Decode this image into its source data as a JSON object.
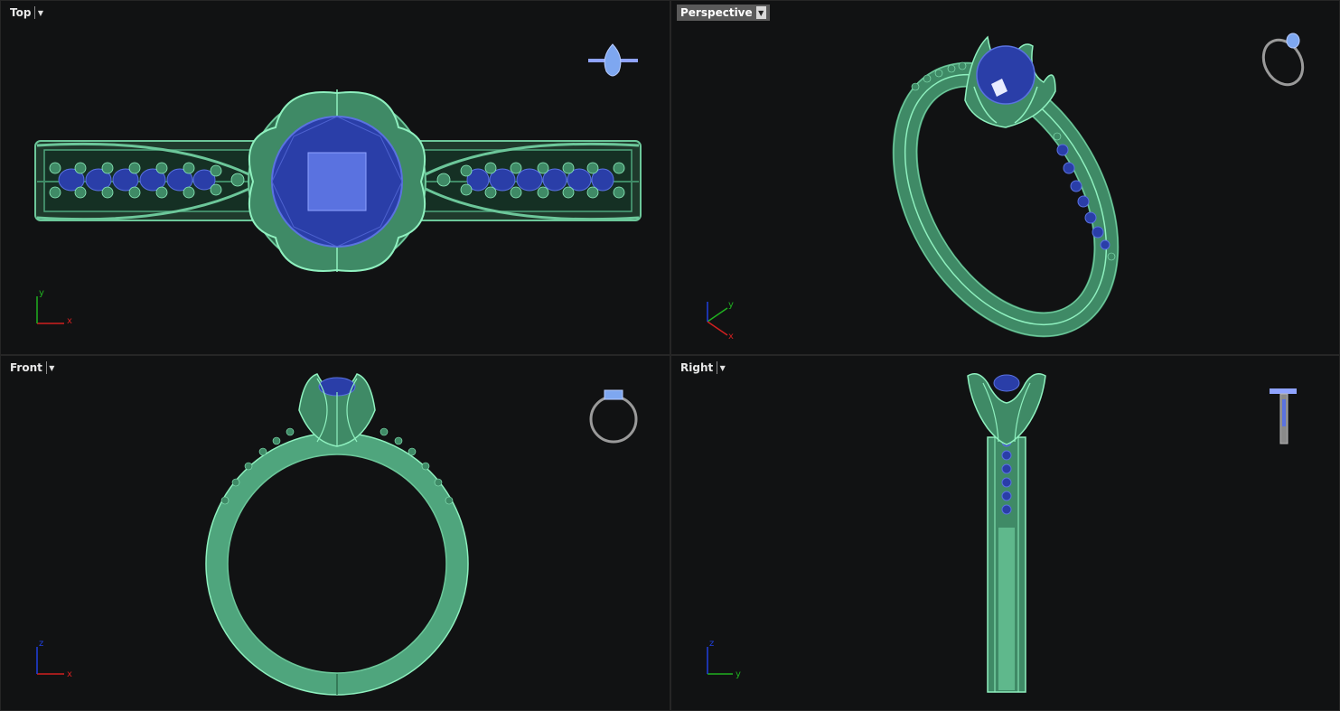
{
  "viewports": {
    "top": {
      "label": "Top",
      "axes": {
        "h": "x",
        "v": "y"
      }
    },
    "perspective": {
      "label": "Perspective",
      "axes": {
        "a": "y",
        "b": "x"
      }
    },
    "front": {
      "label": "Front",
      "axes": {
        "h": "x",
        "v": "z"
      }
    },
    "right": {
      "label": "Right",
      "axes": {
        "h": "y",
        "v": "z"
      }
    }
  },
  "colors": {
    "background": "#111213",
    "metal": "#3f8a66",
    "metal_highlight": "#6cc79a",
    "metal_edge": "#8ff0bf",
    "gem": "#2a3ea8",
    "gem_light": "#5a72e0",
    "axis_x": "#d02020",
    "axis_y": "#20b020",
    "axis_z": "#2040e0",
    "active_label_bg": "#5a5a5a"
  }
}
